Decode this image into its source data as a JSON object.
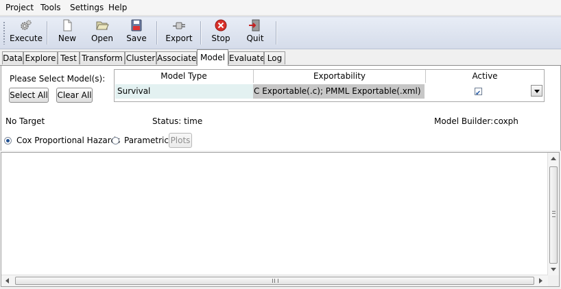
{
  "menu": [
    "Project",
    "Tools",
    "Settings",
    "Help"
  ],
  "toolbar": {
    "execute": "Execute",
    "new": "New",
    "open": "Open",
    "save": "Save",
    "export": "Export",
    "stop": "Stop",
    "quit": "Quit"
  },
  "tabs": [
    "Data",
    "Explore",
    "Test",
    "Transform",
    "Cluster",
    "Associate",
    "Model",
    "Evaluate",
    "Log"
  ],
  "active_tab": "Model",
  "model": {
    "select_label": "Please Select Model(s):",
    "select_all": "Select All",
    "clear_all": "Clear All",
    "table": {
      "headers": [
        "Model Type",
        "Exportability",
        "Active"
      ],
      "row": {
        "type": "Survival",
        "exportability": "C Exportable(.c); PMML Exportable(.xml)",
        "active": true
      }
    },
    "no_target": "No Target",
    "status": "Status: time",
    "builder_label": "Model Builder:",
    "builder_value": "coxph",
    "options": [
      "Cox Proportional Hazards",
      "Parametric"
    ],
    "selected_option": "Cox Proportional Hazards",
    "plots": "Plots"
  },
  "colors": {
    "toolbar_bg": "#dde3ef",
    "row_selected": "#e3f1f1",
    "row_gray": "#c7c7c7",
    "radio_dot": "#1f4f91",
    "stop_red": "#d9302a"
  }
}
